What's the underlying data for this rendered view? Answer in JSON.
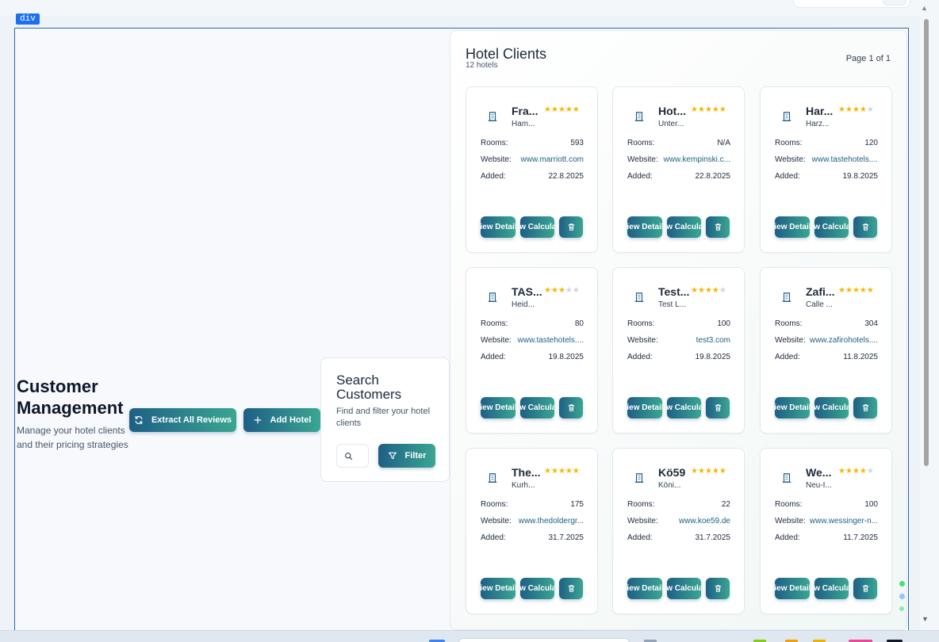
{
  "page": {
    "title": "Customer Management",
    "subtitle": "Manage your hotel clients and their pricing strategies",
    "element_tag": "div"
  },
  "actions": {
    "extract_label": "Extract All Reviews",
    "add_label": "Add Hotel"
  },
  "search": {
    "title": "Search Customers",
    "subtitle": "Find and filter your hotel clients",
    "placeholder": "",
    "filter_label": "Filter"
  },
  "clients": {
    "title": "Hotel Clients",
    "count": "12 hotels",
    "page_info": "Page 1 of 1",
    "labels": {
      "rooms": "Rooms:",
      "website": "Website:",
      "added": "Added:",
      "view": "View Details",
      "calc": "View Calculator"
    },
    "hotels": [
      {
        "name": "Fra...",
        "city": "Ham...",
        "stars": 5,
        "rooms": "593",
        "website": "www.marriott.com",
        "added": "22.8.2025"
      },
      {
        "name": "Hot...",
        "city": "Unter...",
        "stars": 5,
        "rooms": "N/A",
        "website": "www.kempinski.c...",
        "added": "22.8.2025"
      },
      {
        "name": "Har...",
        "city": "Harz...",
        "stars": 4,
        "rooms": "120",
        "website": "www.tastehotels....",
        "added": "19.8.2025"
      },
      {
        "name": "TAS...",
        "city": "Heid...",
        "stars": 3,
        "rooms": "80",
        "website": "www.tastehotels....",
        "added": "19.8.2025"
      },
      {
        "name": "Test...",
        "city": "Test L...",
        "stars": 4,
        "rooms": "100",
        "website": "test3.com",
        "added": "19.8.2025"
      },
      {
        "name": "Zafi...",
        "city": "Calle ...",
        "stars": 5,
        "rooms": "304",
        "website": "www.zafirohotels....",
        "added": "11.8.2025"
      },
      {
        "name": "The...",
        "city": "Kurh...",
        "stars": 5,
        "rooms": "175",
        "website": "www.thedoldergr...",
        "added": "31.7.2025"
      },
      {
        "name": "Kö59",
        "city": "Köni...",
        "stars": 5,
        "rooms": "22",
        "website": "www.koe59.de",
        "added": "31.7.2025"
      },
      {
        "name": "We...",
        "city": "Neu-I...",
        "stars": 4,
        "rooms": "100",
        "website": "www.wessinger-n...",
        "added": "11.7.2025"
      }
    ]
  },
  "colors": {
    "accent_start": "#1e5f86",
    "accent_end": "#3aa692",
    "star": "#f5b700",
    "star_off": "#cbd5e1",
    "link": "#1e5f86"
  },
  "icons": {
    "hotel": "building-icon",
    "extract": "refresh-icon",
    "add": "plus-icon",
    "search": "search-icon",
    "filter": "filter-icon",
    "delete": "trash-icon"
  }
}
